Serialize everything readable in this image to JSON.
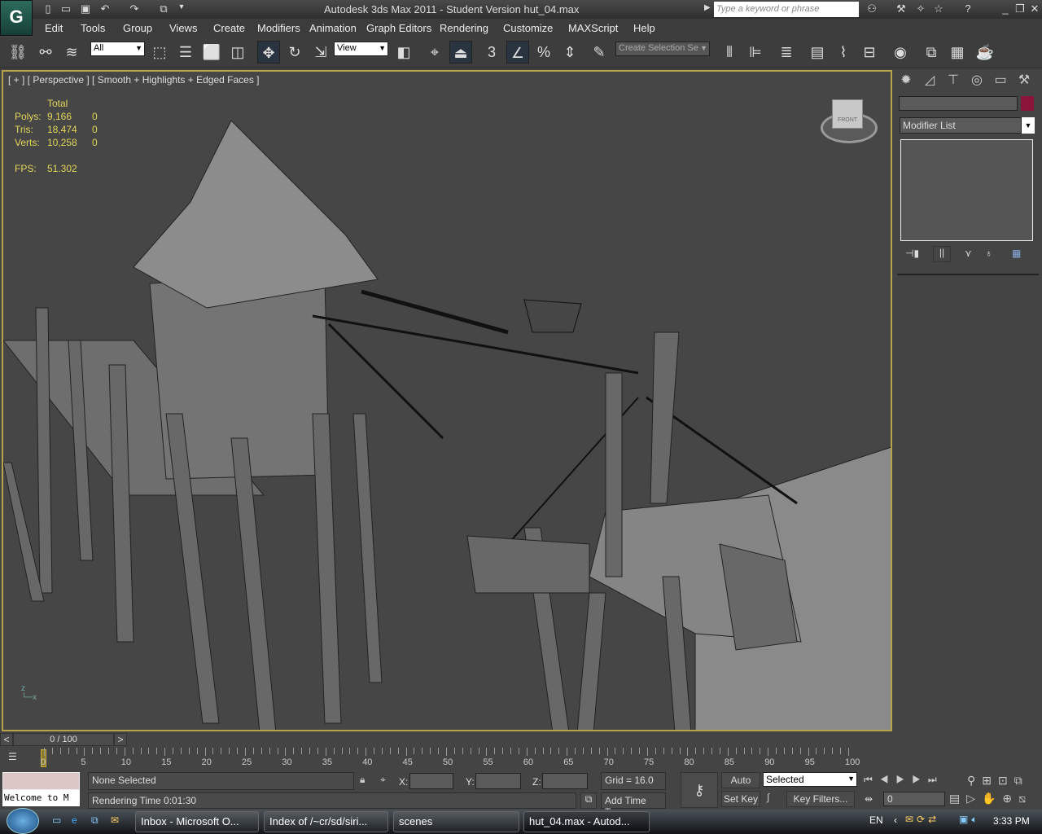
{
  "app": {
    "title": "Autodesk 3ds Max  2011   - Student Version    hut_04.max",
    "search_placeholder": "Type a keyword or phrase"
  },
  "menu": [
    "Edit",
    "Tools",
    "Group",
    "Views",
    "Create",
    "Modifiers",
    "Animation",
    "Graph Editors",
    "Rendering",
    "Customize",
    "MAXScript",
    "Help"
  ],
  "toolbar": {
    "selection_filter": "All",
    "reference_coord": "View",
    "named_selection": "Create Selection Se",
    "snap_label": "3"
  },
  "viewport": {
    "label": "[ + ] [ Perspective ] [ Smooth + Highlights + Edged Faces ]",
    "stats": {
      "header": "Total",
      "rows": [
        {
          "label": "Polys:",
          "total": "9,166",
          "sel": "0"
        },
        {
          "label": "Tris:",
          "total": "18,474",
          "sel": "0"
        },
        {
          "label": "Verts:",
          "total": "10,258",
          "sel": "0"
        }
      ],
      "fps_label": "FPS:",
      "fps": "51.302"
    },
    "viewcube_label": "FRONT"
  },
  "command_panel": {
    "modifier_list": "Modifier List",
    "color_swatch": "#8a1538"
  },
  "timeline": {
    "frame": "0 / 100",
    "prev": "<",
    "next": ">",
    "ticks": [
      "0",
      "5",
      "10",
      "15",
      "20",
      "25",
      "30",
      "35",
      "40",
      "45",
      "50",
      "55",
      "60",
      "65",
      "70",
      "75",
      "80",
      "85",
      "90",
      "95",
      "100"
    ]
  },
  "status": {
    "maxscript_output": "Welcome to M",
    "selection": "None Selected",
    "prompt": "Rendering Time  0:01:30",
    "x_label": "X:",
    "y_label": "Y:",
    "z_label": "Z:",
    "grid": "Grid = 16.0",
    "add_time_tag": "Add Time Tag",
    "auto_key": "Auto Key",
    "set_key": "Set Key",
    "key_mode": "Selected",
    "key_filters": "Key Filters...",
    "current_frame": "0"
  },
  "taskbar": {
    "tasks": [
      "Inbox - Microsoft O...",
      "Index of /~cr/sd/siri...",
      "scenes",
      "hut_04.max - Autod..."
    ],
    "lang": "EN",
    "time": "3:33 PM"
  }
}
